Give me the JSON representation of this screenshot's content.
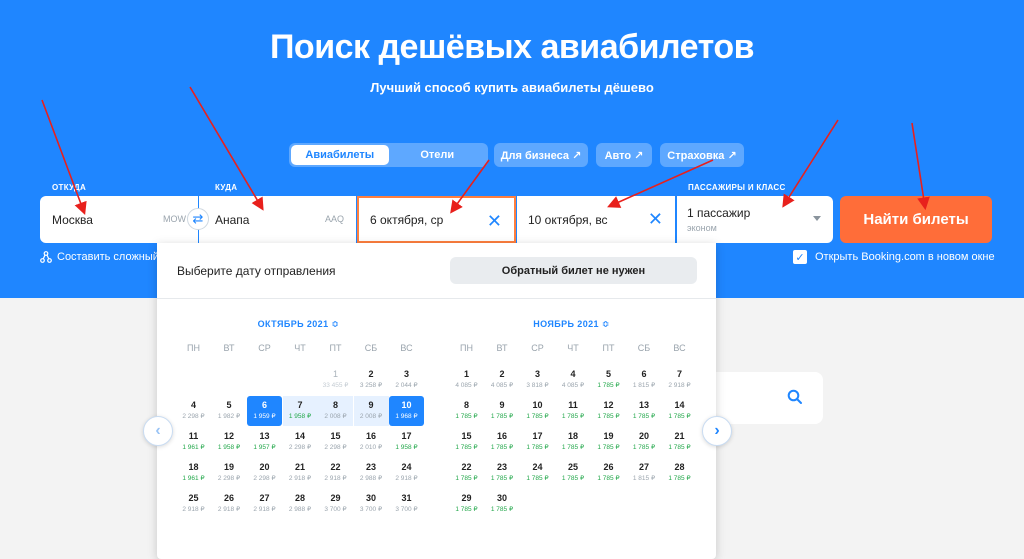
{
  "hero": {
    "title": "Поиск дешёвых авиабилетов",
    "subtitle": "Лучший способ купить авиабилеты дёшево"
  },
  "tabs": [
    {
      "label": "Авиабилеты",
      "active": true
    },
    {
      "label": "Отели",
      "active": false
    }
  ],
  "pills": [
    {
      "label": "Для бизнеса ↗"
    },
    {
      "label": "Авто ↗"
    },
    {
      "label": "Страховка ↗"
    }
  ],
  "form": {
    "from_label": "ОТКУДА",
    "from_value": "Москва",
    "from_code": "MOW",
    "to_label": "КУДА",
    "to_value": "Анапа",
    "to_code": "AAQ",
    "depart_value": "6 октября, ср",
    "return_value": "10 октября, вс",
    "pax_label": "ПАССАЖИРЫ И КЛАСС",
    "pax_value": "1 пассажир",
    "class_value": "эконом",
    "search_label": "Найти билеты",
    "route_link": "Составить сложный",
    "booking_label": "Открыть Booking.com в новом окне",
    "booking_checked": true
  },
  "calendar": {
    "title": "Выберите дату отправления",
    "no_return_label": "Обратный билет не нужен",
    "weekdays": [
      "ПН",
      "ВТ",
      "СР",
      "ЧТ",
      "ПТ",
      "СБ",
      "ВС"
    ],
    "selected_depart": 6,
    "selected_return": 10,
    "months": [
      {
        "name": "ОКТЯБРЬ 2021 ≎",
        "first_weekday": 4,
        "days": [
          {
            "d": "1",
            "p": "33 455 ₽",
            "past": true
          },
          {
            "d": "2",
            "p": "3 258 ₽"
          },
          {
            "d": "3",
            "p": "2 044 ₽"
          },
          {
            "d": "4",
            "p": "2 298 ₽"
          },
          {
            "d": "5",
            "p": "1 982 ₽"
          },
          {
            "d": "6",
            "p": "1 959 ₽",
            "cheap": true
          },
          {
            "d": "7",
            "p": "1 958 ₽",
            "cheap": true
          },
          {
            "d": "8",
            "p": "2 008 ₽"
          },
          {
            "d": "9",
            "p": "2 008 ₽"
          },
          {
            "d": "10",
            "p": "1 968 ₽",
            "cheap": true
          },
          {
            "d": "11",
            "p": "1 961 ₽",
            "cheap": true
          },
          {
            "d": "12",
            "p": "1 958 ₽",
            "cheap": true
          },
          {
            "d": "13",
            "p": "1 957 ₽",
            "cheap": true
          },
          {
            "d": "14",
            "p": "2 298 ₽"
          },
          {
            "d": "15",
            "p": "2 298 ₽"
          },
          {
            "d": "16",
            "p": "2 010 ₽"
          },
          {
            "d": "17",
            "p": "1 958 ₽",
            "cheap": true
          },
          {
            "d": "18",
            "p": "1 961 ₽",
            "cheap": true
          },
          {
            "d": "19",
            "p": "2 298 ₽"
          },
          {
            "d": "20",
            "p": "2 298 ₽"
          },
          {
            "d": "21",
            "p": "2 918 ₽"
          },
          {
            "d": "22",
            "p": "2 918 ₽"
          },
          {
            "d": "23",
            "p": "2 988 ₽"
          },
          {
            "d": "24",
            "p": "2 918 ₽"
          },
          {
            "d": "25",
            "p": "2 918 ₽"
          },
          {
            "d": "26",
            "p": "2 918 ₽"
          },
          {
            "d": "27",
            "p": "2 918 ₽"
          },
          {
            "d": "28",
            "p": "2 988 ₽"
          },
          {
            "d": "29",
            "p": "3 700 ₽"
          },
          {
            "d": "30",
            "p": "3 700 ₽"
          },
          {
            "d": "31",
            "p": "3 700 ₽"
          }
        ]
      },
      {
        "name": "НОЯБРЬ 2021 ≎",
        "first_weekday": 0,
        "days": [
          {
            "d": "1",
            "p": "4 085 ₽"
          },
          {
            "d": "2",
            "p": "4 085 ₽"
          },
          {
            "d": "3",
            "p": "3 818 ₽"
          },
          {
            "d": "4",
            "p": "4 085 ₽"
          },
          {
            "d": "5",
            "p": "1 785 ₽",
            "cheap": true
          },
          {
            "d": "6",
            "p": "1 815 ₽"
          },
          {
            "d": "7",
            "p": "2 918 ₽"
          },
          {
            "d": "8",
            "p": "1 785 ₽",
            "cheap": true
          },
          {
            "d": "9",
            "p": "1 785 ₽",
            "cheap": true
          },
          {
            "d": "10",
            "p": "1 785 ₽",
            "cheap": true
          },
          {
            "d": "11",
            "p": "1 785 ₽",
            "cheap": true
          },
          {
            "d": "12",
            "p": "1 785 ₽",
            "cheap": true
          },
          {
            "d": "13",
            "p": "1 785 ₽",
            "cheap": true
          },
          {
            "d": "14",
            "p": "1 785 ₽",
            "cheap": true
          },
          {
            "d": "15",
            "p": "1 785 ₽",
            "cheap": true
          },
          {
            "d": "16",
            "p": "1 785 ₽",
            "cheap": true
          },
          {
            "d": "17",
            "p": "1 785 ₽",
            "cheap": true
          },
          {
            "d": "18",
            "p": "1 785 ₽",
            "cheap": true
          },
          {
            "d": "19",
            "p": "1 785 ₽",
            "cheap": true
          },
          {
            "d": "20",
            "p": "1 785 ₽",
            "cheap": true
          },
          {
            "d": "21",
            "p": "1 785 ₽",
            "cheap": true
          },
          {
            "d": "22",
            "p": "1 785 ₽",
            "cheap": true
          },
          {
            "d": "23",
            "p": "1 785 ₽",
            "cheap": true
          },
          {
            "d": "24",
            "p": "1 785 ₽",
            "cheap": true
          },
          {
            "d": "25",
            "p": "1 785 ₽",
            "cheap": true
          },
          {
            "d": "26",
            "p": "1 785 ₽",
            "cheap": true
          },
          {
            "d": "27",
            "p": "1 815 ₽"
          },
          {
            "d": "28",
            "p": "1 785 ₽",
            "cheap": true
          },
          {
            "d": "29",
            "p": "1 785 ₽",
            "cheap": true
          },
          {
            "d": "30",
            "p": "1 785 ₽",
            "cheap": true
          }
        ]
      }
    ]
  },
  "colors": {
    "brand_blue": "#1f86ff",
    "accent_orange": "#ff6d39",
    "price_green": "#22a74a",
    "annotation_red": "#e8201c"
  },
  "icons": [
    "swap-icon",
    "close-icon",
    "chevron-down-icon",
    "route-icon",
    "checkbox-check-icon",
    "search-icon",
    "chevron-left-icon",
    "chevron-right-icon"
  ]
}
